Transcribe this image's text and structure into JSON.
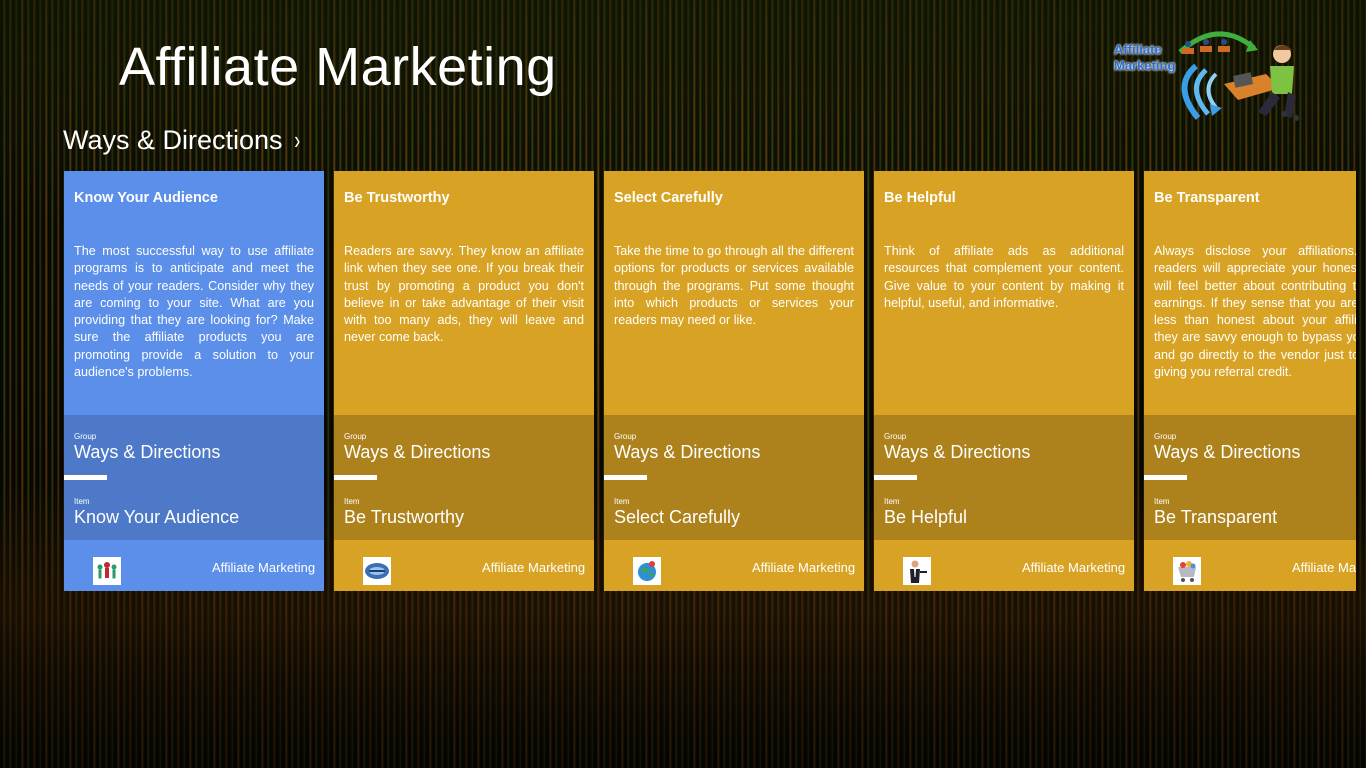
{
  "app": {
    "title": "Affiliate Marketing",
    "logo_text_line1": "Affiliate",
    "logo_text_line2": "Marketing"
  },
  "section": {
    "title": "Ways & Directions",
    "chevron": "›"
  },
  "colors": {
    "card_primary_blue": "#5b8fe9",
    "card_band_blue": "#4d79c8",
    "card_primary_gold": "#d8a324",
    "card_band_gold": "#ad821c"
  },
  "cards": [
    {
      "title": "Know Your Audience",
      "body": "The most successful way to use affiliate programs is to anticipate and meet the needs of your readers. Consider why they are coming to your site. What are you providing that they are looking for? Make sure the affiliate products you are promoting provide a solution to your audience's problems.",
      "group_label": "Group",
      "group_value": "Ways & Directions",
      "item_label": "Item",
      "item_value": "Know Your Audience",
      "footer_label": "Affiliate Marketing",
      "thumb_icon": "people-icon"
    },
    {
      "title": "Be Trustworthy",
      "body": "Readers are savvy. They know an affiliate link when they see one. If you break their trust by promoting a product you don't believe in or take advantage of their visit with too many ads, they will leave and never come back.",
      "group_label": "Group",
      "group_value": "Ways & Directions",
      "item_label": "Item",
      "item_value": "Be Trustworthy",
      "footer_label": "Affiliate Marketing",
      "thumb_icon": "wordcloud-icon"
    },
    {
      "title": "Select Carefully",
      "body": "Take the time to go through all the different options for products or services available through the programs. Put some thought into which products or services your readers may need or like.",
      "group_label": "Group",
      "group_value": "Ways & Directions",
      "item_label": "Item",
      "item_value": "Select Carefully",
      "footer_label": "Affiliate Marketing",
      "thumb_icon": "globe-icon"
    },
    {
      "title": "Be Helpful",
      "body": "Think of affiliate ads as additional resources that complement your content. Give value to your content by making it helpful, useful, and informative.",
      "group_label": "Group",
      "group_value": "Ways & Directions",
      "item_label": "Item",
      "item_value": "Be Helpful",
      "footer_label": "Affiliate Marketing",
      "thumb_icon": "businessman-icon"
    },
    {
      "title": "Be Transparent",
      "body": "Always disclose your affiliations. Your readers will appreciate your honesty and will feel better about contributing to your earnings. If they sense that you are being less than honest about your affiliations, they are savvy enough to bypass your link and go directly to the vendor just to avoid giving you referral credit.",
      "group_label": "Group",
      "group_value": "Ways & Directions",
      "item_label": "Item",
      "item_value": "Be Transparent",
      "footer_label": "Affiliate Marketing",
      "thumb_icon": "shopping-cart-icon"
    }
  ]
}
